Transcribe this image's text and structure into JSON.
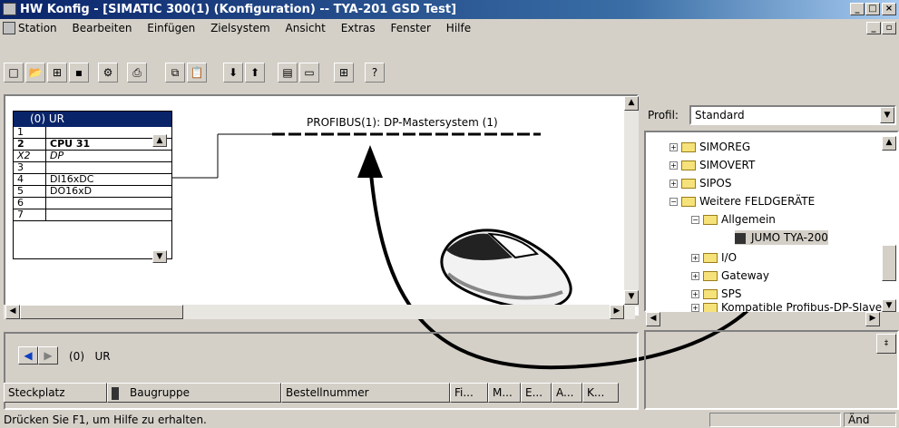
{
  "window": {
    "title": "HW Konfig - [SIMATIC 300(1) (Konfiguration) -- TYA-201 GSD Test]"
  },
  "menu": [
    "Station",
    "Bearbeiten",
    "Einfügen",
    "Zielsystem",
    "Ansicht",
    "Extras",
    "Fenster",
    "Hilfe"
  ],
  "rack": {
    "title": "(0) UR",
    "rows": [
      [
        "1",
        ""
      ],
      [
        "2",
        "CPU 31"
      ],
      [
        "X2",
        "DP"
      ],
      [
        "3",
        ""
      ],
      [
        "4",
        "DI16xDC"
      ],
      [
        "5",
        "DO16xD"
      ],
      [
        "6",
        ""
      ],
      [
        "7",
        ""
      ]
    ]
  },
  "profibus_label": "PROFIBUS(1): DP-Mastersystem (1)",
  "profil": {
    "label": "Profil:",
    "value": "Standard"
  },
  "tree": [
    "SIMOREG",
    "SIMOVERT",
    "SIPOS",
    "Weitere FELDGERÄTE",
    "Allgemein",
    "JUMO TYA-200",
    "I/O",
    "Gateway",
    "SPS",
    "Kompatible Profibus-DP-Slaves"
  ],
  "bottom": {
    "rack_label": "(0)   UR",
    "columns": [
      "Steckplatz",
      "Baugruppe",
      "Bestellnummer",
      "Fi...",
      "M...",
      "E...",
      "A...",
      "K..."
    ]
  },
  "status": {
    "text": "Drücken Sie F1, um Hilfe zu erhalten.",
    "mode": "Änd"
  }
}
